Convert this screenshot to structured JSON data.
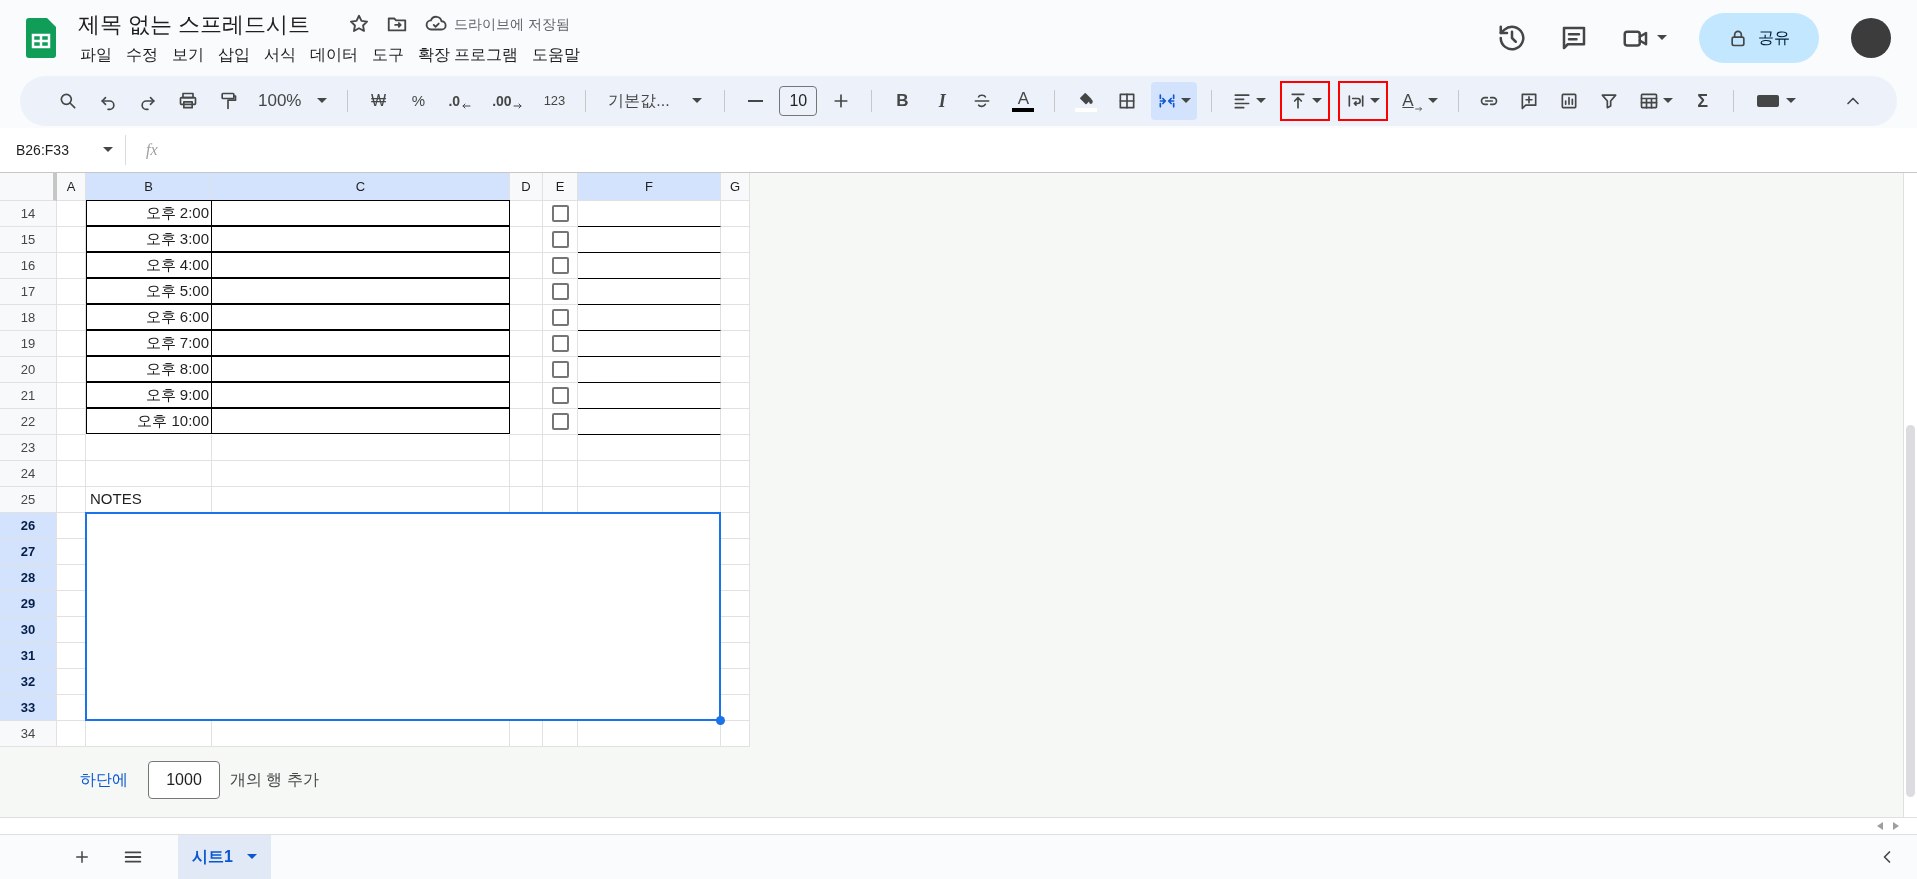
{
  "document": {
    "title": "제목 없는 스프레드시트",
    "save_status": "드라이브에 저장됨"
  },
  "menu": [
    "파일",
    "수정",
    "보기",
    "삽입",
    "서식",
    "데이터",
    "도구",
    "확장 프로그램",
    "도움말"
  ],
  "share_button": "공유",
  "toolbar": {
    "zoom": "100%",
    "currency": "₩",
    "percent": "%",
    "decrease_decimal": ".0",
    "increase_decimal": ".00",
    "more_formats": "123",
    "font": "기본값...",
    "font_size": "10",
    "bold": "B",
    "italic": "I",
    "text_color": "A",
    "text_rotation": "A",
    "sum": "Σ",
    "merge_selected": true,
    "valign_highlighted": true,
    "wrap_highlighted": true
  },
  "name_box": "B26:F33",
  "formula_label": "fx",
  "columns": [
    {
      "label": "A",
      "selected": false
    },
    {
      "label": "B",
      "selected": true
    },
    {
      "label": "C",
      "selected": true
    },
    {
      "label": "D",
      "selected": false
    },
    {
      "label": "E",
      "selected": false
    },
    {
      "label": "F",
      "selected": true
    },
    {
      "label": "G",
      "selected": false
    }
  ],
  "rows": [
    {
      "number": "14",
      "kind": "timeslot",
      "time": "오후 2:00",
      "checked": false,
      "selected": false
    },
    {
      "number": "15",
      "kind": "timeslot",
      "time": "오후 3:00",
      "checked": false,
      "selected": false
    },
    {
      "number": "16",
      "kind": "timeslot",
      "time": "오후 4:00",
      "checked": false,
      "selected": false
    },
    {
      "number": "17",
      "kind": "timeslot",
      "time": "오후 5:00",
      "checked": false,
      "selected": false
    },
    {
      "number": "18",
      "kind": "timeslot",
      "time": "오후 6:00",
      "checked": false,
      "selected": false
    },
    {
      "number": "19",
      "kind": "timeslot",
      "time": "오후 7:00",
      "checked": false,
      "selected": false
    },
    {
      "number": "20",
      "kind": "timeslot",
      "time": "오후 8:00",
      "checked": false,
      "selected": false
    },
    {
      "number": "21",
      "kind": "timeslot",
      "time": "오후 9:00",
      "checked": false,
      "selected": false
    },
    {
      "number": "22",
      "kind": "timeslot",
      "time": "오후 10:00",
      "checked": false,
      "selected": false
    },
    {
      "number": "23",
      "kind": "blank",
      "selected": false
    },
    {
      "number": "24",
      "kind": "blank",
      "selected": false
    },
    {
      "number": "25",
      "kind": "notes",
      "label": "NOTES",
      "selected": false
    },
    {
      "number": "26",
      "kind": "blank",
      "selected": true
    },
    {
      "number": "27",
      "kind": "blank",
      "selected": true
    },
    {
      "number": "28",
      "kind": "blank",
      "selected": true
    },
    {
      "number": "29",
      "kind": "blank",
      "selected": true
    },
    {
      "number": "30",
      "kind": "blank",
      "selected": true
    },
    {
      "number": "31",
      "kind": "blank",
      "selected": true
    },
    {
      "number": "32",
      "kind": "blank",
      "selected": true
    },
    {
      "number": "33",
      "kind": "blank",
      "selected": true
    },
    {
      "number": "34",
      "kind": "blank",
      "selected": false
    }
  ],
  "add_rows": {
    "link": "하단에",
    "count": "1000",
    "suffix": "개의 행 추가"
  },
  "sheets": [
    {
      "name": "시트1",
      "selected": true
    }
  ]
}
